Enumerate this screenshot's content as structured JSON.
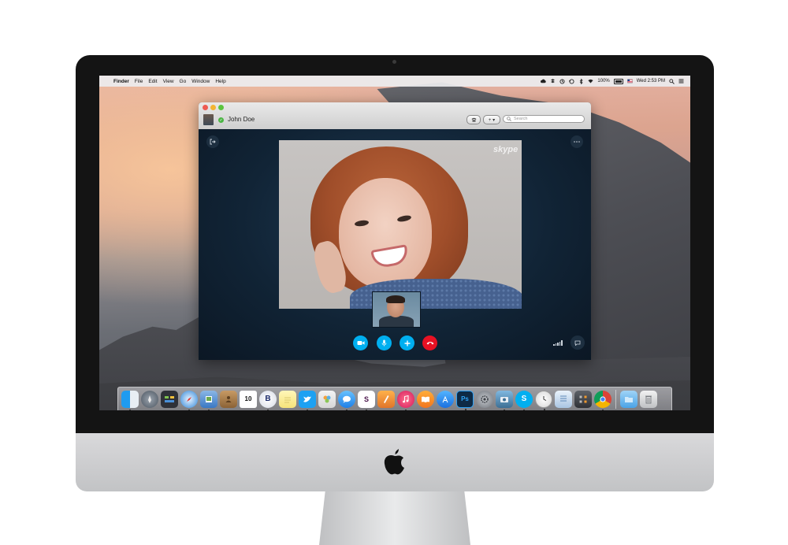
{
  "menubar": {
    "apple": "",
    "items": [
      {
        "label": "Finder",
        "bold": true
      },
      {
        "label": "File"
      },
      {
        "label": "Edit"
      },
      {
        "label": "View"
      },
      {
        "label": "Go"
      },
      {
        "label": "Window"
      },
      {
        "label": "Help"
      }
    ],
    "status": {
      "battery_text": "100%",
      "clock_text": "Wed 2:53 PM"
    },
    "status_icons": [
      "creative-cloud-icon",
      "dropbox-icon",
      "sync-icon",
      "time-machine-icon",
      "bluetooth-icon",
      "wifi-icon",
      "battery-icon",
      "flag-icon",
      "spotlight-icon",
      "notification-center-icon"
    ]
  },
  "skype": {
    "contact_name": "John Doe",
    "search_placeholder": "Search",
    "watermark": "skype",
    "add_button_label": "+ ▾",
    "colors": {
      "accent": "#00aff0",
      "hangup": "#e81123",
      "presence": "#4bb543"
    },
    "controls": [
      "video-icon",
      "mic-icon",
      "add-icon",
      "hangup-icon"
    ]
  },
  "dock": {
    "calendar_day": "10",
    "photoshop_label": "Ps",
    "skype_label": "S",
    "icons": [
      "finder-icon",
      "launchpad-icon",
      "mission-control-icon",
      "safari-icon",
      "preview-icon",
      "contacts-icon",
      "calendar-icon",
      "bbedit-icon",
      "notes-icon",
      "twitter-icon",
      "photos-icon",
      "messages-icon",
      "slack-icon",
      "ibooks-author-icon",
      "itunes-icon",
      "ibooks-icon",
      "app-store-icon",
      "photoshop-icon",
      "system-preferences-icon",
      "image-capture-icon",
      "skype-icon",
      "clock-icon",
      "font-book-icon",
      "calculator-icon",
      "chrome-icon",
      "downloads-folder-icon",
      "trash-icon"
    ]
  }
}
